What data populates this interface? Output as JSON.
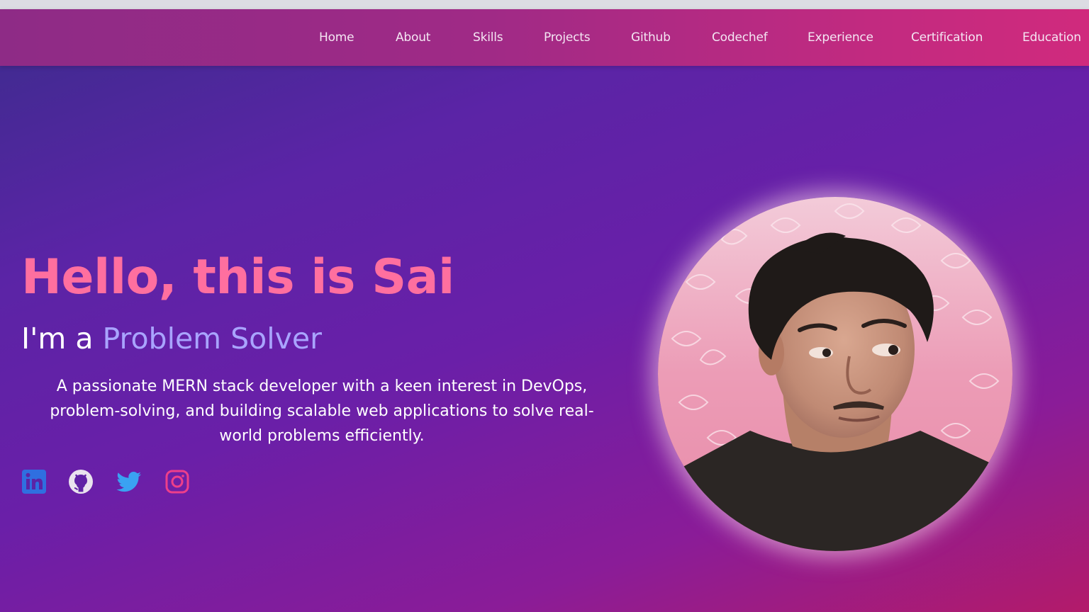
{
  "nav": {
    "items": [
      {
        "label": "Home"
      },
      {
        "label": "About"
      },
      {
        "label": "Skills"
      },
      {
        "label": "Projects"
      },
      {
        "label": "Github"
      },
      {
        "label": "Codechef"
      },
      {
        "label": "Experience"
      },
      {
        "label": "Certification"
      },
      {
        "label": "Education"
      }
    ]
  },
  "hero": {
    "title": "Hello, this is Sai",
    "subtitle_prefix": "I'm a ",
    "subtitle_role": "Problem Solver",
    "description": "A passionate MERN stack developer with a keen interest in DevOps, problem-solving, and building scalable web applications to solve real-world problems efficiently."
  },
  "social": [
    {
      "icon": "linkedin-icon",
      "color": "#2f6fe0"
    },
    {
      "icon": "github-icon",
      "color": "#e9e3ee"
    },
    {
      "icon": "twitter-icon",
      "color": "#3aa2f2"
    },
    {
      "icon": "instagram-icon",
      "color": "#ee3f8a"
    }
  ],
  "colors": {
    "title": "#ff6f9f",
    "role": "#a9a4ff",
    "navbar": "#a02a86"
  }
}
